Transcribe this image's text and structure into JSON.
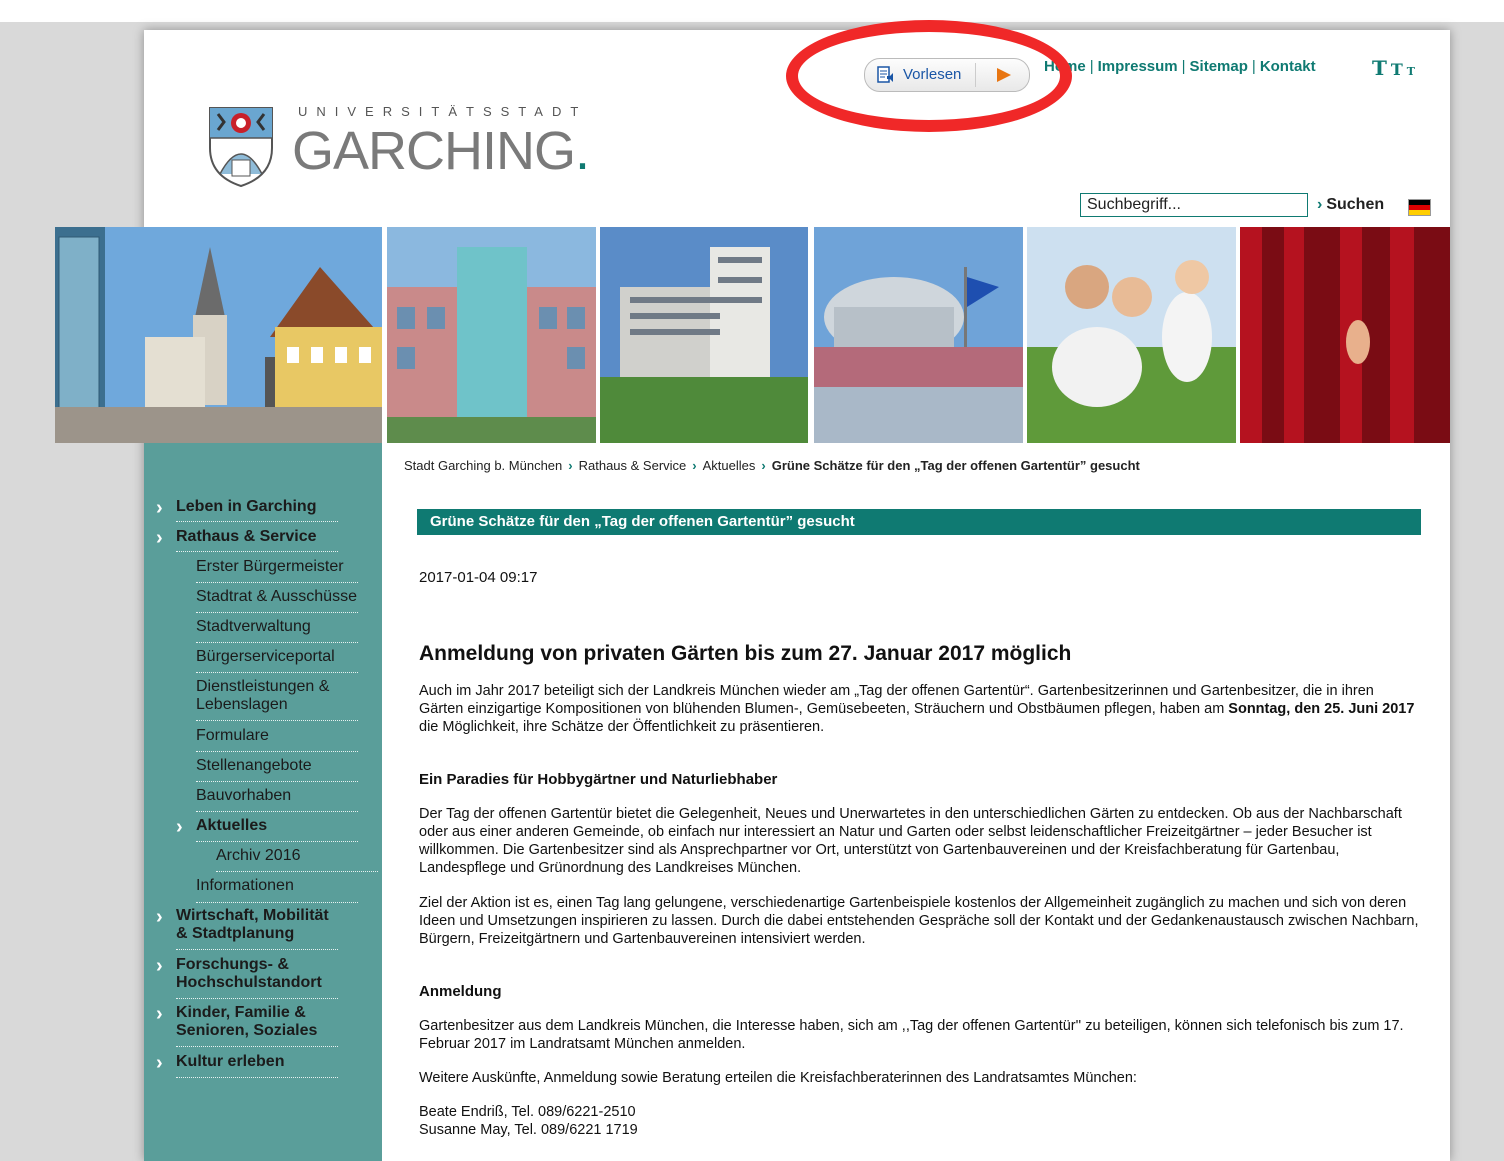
{
  "header": {
    "logo_small": "UNIVERSITÄTSSTADT",
    "logo_big": "GARCHING",
    "logo_dot": ".",
    "vorlesen_label": "Vorlesen",
    "nav": [
      "Home",
      "Impressum",
      "Sitemap",
      "Kontakt"
    ],
    "fontsize": [
      "T",
      "T",
      "T"
    ],
    "search_placeholder": "Suchbegriff...",
    "search_button": "Suchen"
  },
  "colors": {
    "accent": "#0f7a72",
    "sidebar": "#5a9e9a",
    "annotation_ring": "#f02828",
    "play": "#e87511"
  },
  "banner_images": [
    "town-square-church",
    "rathaus-building",
    "office-buildings",
    "university-campus-festival",
    "family-in-meadow",
    "red-curtain"
  ],
  "sidebar": {
    "items": [
      {
        "label": "Leben in Garching",
        "level": 1
      },
      {
        "label": "Rathaus & Service",
        "level": 1
      },
      {
        "label": "Erster Bürgermeister",
        "level": 2
      },
      {
        "label": "Stadtrat & Ausschüsse",
        "level": 2
      },
      {
        "label": "Stadtverwaltung",
        "level": 2
      },
      {
        "label": "Bürgerserviceportal",
        "level": 2
      },
      {
        "label": "Dienstleistungen &",
        "label2": "Lebenslagen",
        "level": 2
      },
      {
        "label": "Formulare",
        "level": 2
      },
      {
        "label": "Stellenangebote",
        "level": 2
      },
      {
        "label": "Bauvorhaben",
        "level": 2
      },
      {
        "label": "Aktuelles",
        "level": 2
      },
      {
        "label": "Archiv 2016",
        "level": 3
      },
      {
        "label": "Informationen",
        "level": 2
      },
      {
        "label": "Wirtschaft, Mobilität",
        "label2": "& Stadtplanung",
        "level": 1
      },
      {
        "label": "Forschungs- &",
        "label2": "Hochschulstandort",
        "level": 1
      },
      {
        "label": "Kinder, Familie &",
        "label2": "Senioren, Soziales",
        "level": 1
      },
      {
        "label": "Kultur erleben",
        "level": 1
      }
    ]
  },
  "breadcrumb": [
    "Stadt Garching b. München",
    "Rathaus & Service",
    "Aktuelles",
    "Grüne Schätze für den „Tag der offenen Gartentür” gesucht"
  ],
  "article": {
    "title_bar": "Grüne Schätze für den „Tag der offenen Gartentür” gesucht",
    "date": "2017-01-04 09:17",
    "heading": "Anmeldung von privaten Gärten bis zum 27. Januar 2017 möglich",
    "p1_a": "Auch im Jahr 2017 beteiligt sich der Landkreis München wieder am „Tag der offenen Gartentür“. Gartenbesitzerinnen und Gartenbesitzer, die in ihren Gärten einzigartige Kompositionen von blühenden Blumen-, Gemüsebeeten, Sträuchern und Obstbäumen pflegen, haben am ",
    "p1_b": "Sonntag, den 25. Juni 2017",
    "p1_c": " die Möglichkeit, ihre Schätze der Öffentlichkeit zu präsentieren.",
    "sub1": "Ein Paradies für Hobbygärtner und Naturliebhaber",
    "p2": "Der Tag der offenen Gartentür bietet die Gelegenheit, Neues und Unerwartetes in den unterschiedlichen Gärten zu entdecken. Ob aus der Nachbarschaft oder aus einer anderen Gemeinde, ob einfach nur interessiert an Natur und Garten oder selbst leidenschaftlicher Freizeitgärtner – jeder Besucher ist willkommen. Die Gartenbesitzer sind als Ansprechpartner vor Ort, unterstützt von Gartenbauvereinen und der Kreisfachberatung für Gartenbau, Landespflege und Grünordnung des Landkreises München.",
    "p3": "Ziel der Aktion ist es, einen Tag lang gelungene, verschiedenartige Gartenbeispiele kostenlos der Allgemeinheit zugänglich zu machen und sich von deren Ideen und Umsetzungen inspirieren zu lassen. Durch die dabei entstehenden Gespräche soll der Kontakt und der Gedankenaustausch zwischen Nachbarn, Bürgern, Freizeitgärtnern und Gartenbauvereinen intensiviert werden.",
    "sub2": "Anmeldung",
    "p4": "Gartenbesitzer aus dem Landkreis München, die Interesse haben, sich am ,,Tag der offenen Gartentür'' zu beteiligen, können sich telefonisch bis zum 17. Februar 2017 im Landratsamt München anmelden.",
    "p5": "Weitere Auskünfte, Anmeldung sowie Beratung erteilen die Kreisfachberaterinnen des Landratsamtes München:",
    "contact1": "Beate Endriß, Tel. 089/6221-2510",
    "contact2": "Susanne May, Tel. 089/6221 1719"
  }
}
